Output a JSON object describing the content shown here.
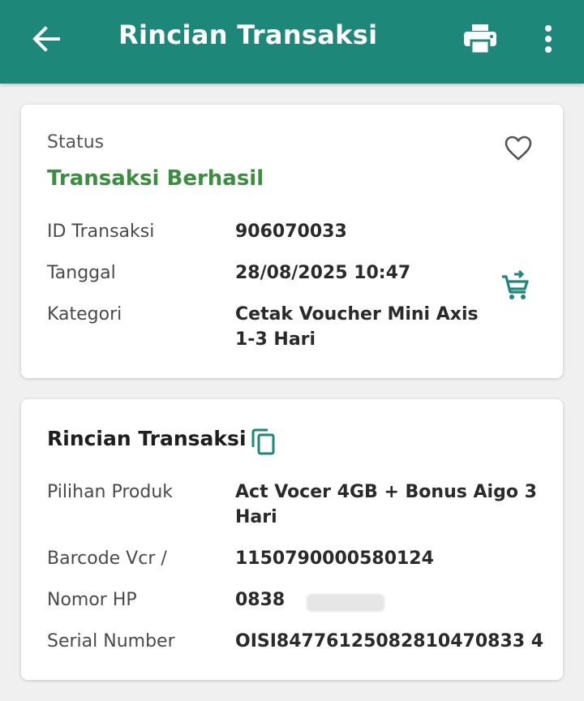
{
  "header": {
    "title": "Rincian Transaksi",
    "back_icon": "arrow-back-icon",
    "print_icon": "printer-icon",
    "more_icon": "more-vert-icon",
    "background_color": "#1d8779"
  },
  "summary": {
    "status_label": "Status",
    "status_value": "Transaksi Berhasil",
    "status_color": "#3a8e3f",
    "favorite_icon": "heart-outline-icon",
    "reorder_icon": "add-cart-icon",
    "rows": [
      {
        "label": "ID Transaksi",
        "value": "906070033"
      },
      {
        "label": "Tanggal",
        "value": "28/08/2025 10:47"
      },
      {
        "label": "Kategori",
        "value_line1": "Cetak Voucher Mini Axis",
        "value_line2": "1-3 Hari"
      }
    ]
  },
  "details": {
    "title": "Rincian Transaksi",
    "copy_icon": "copy-icon",
    "rows": [
      {
        "label": "Pilihan Produk",
        "value_line1": "Act Vocer 4GB + Bonus Aigo 3",
        "value_line2": "Hari"
      },
      {
        "label": "Barcode Vcr /",
        "value": "1150790000580124"
      },
      {
        "label": "Nomor HP",
        "value": "0838"
      },
      {
        "label": "Serial Number",
        "value": "OISI84776125082810470833 4"
      }
    ]
  }
}
